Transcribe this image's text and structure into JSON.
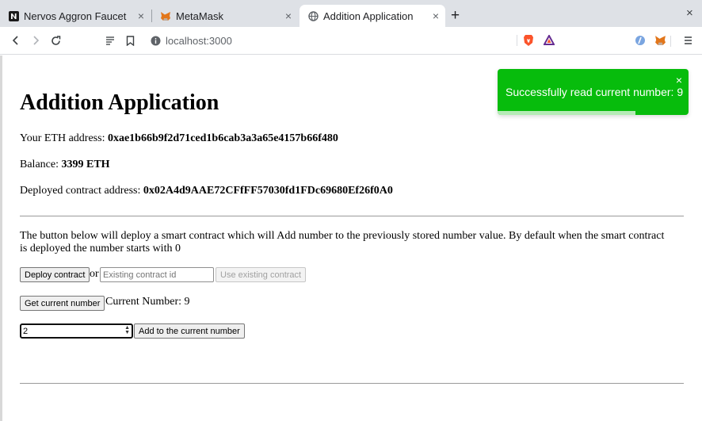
{
  "browser": {
    "tabs": [
      {
        "title": "Nervos Aggron Faucet",
        "icon": "nervos-icon",
        "active": false
      },
      {
        "title": "MetaMask",
        "icon": "metamask-fox-icon",
        "active": false
      },
      {
        "title": "Addition Application",
        "icon": "globe-icon",
        "active": true
      }
    ],
    "new_tab": "+",
    "window_close": "×",
    "tab_close": "×",
    "address": "localhost:3000"
  },
  "page": {
    "title": "Addition Application",
    "eth_address_label": "Your ETH address: ",
    "eth_address": "0xae1b66b9f2d71ced1b6cab3a3a65e4157b66f480",
    "balance_label": "Balance: ",
    "balance": "3399 ETH",
    "contract_label": "Deployed contract address: ",
    "contract_address": "0x02A4d9AAE72CFfFF57030fd1FDc69680Ef26f0A0",
    "description": "The button below will deploy a smart contract which will Add number to the previously stored number value. By default when the smart contract is deployed the number starts with 0",
    "deploy_button": "Deploy contract",
    "or_text": "or",
    "existing_contract_placeholder": "Existing contract id",
    "use_existing_button": "Use existing contract",
    "get_number_button": "Get current number",
    "current_number_text": "Current Number: 9",
    "number_input_value": "2",
    "add_button": "Add to the current number"
  },
  "toast": {
    "message": "Successfully read current number: 9",
    "close": "×",
    "color": "#07bc0c"
  }
}
